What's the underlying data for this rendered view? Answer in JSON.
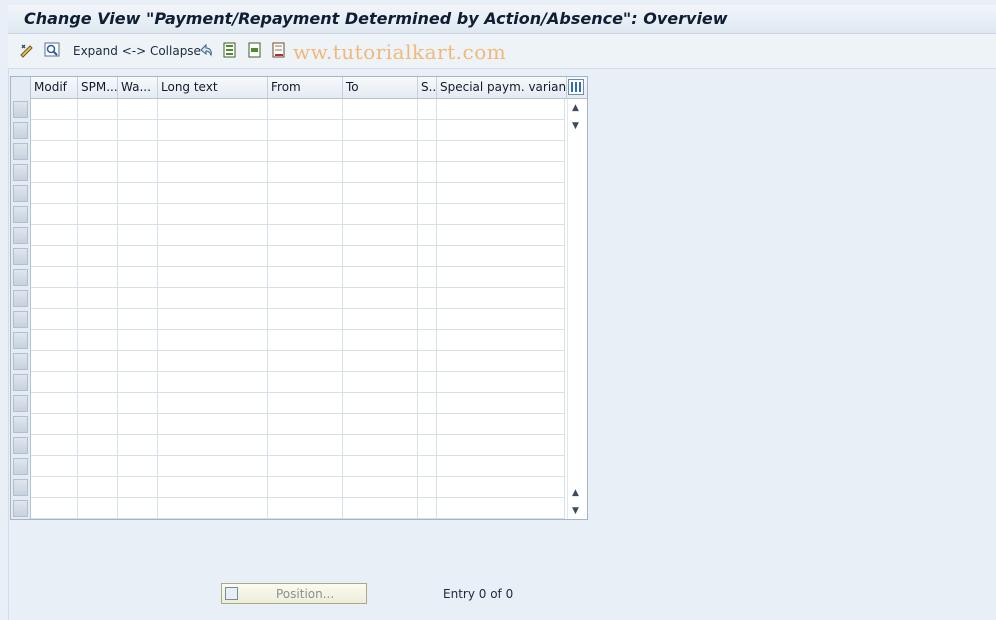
{
  "window": {
    "title": "Change View \"Payment/Repayment Determined by Action/Absence\": Overview"
  },
  "toolbar": {
    "expand_collapse_label": "Expand <-> Collapse",
    "icons": [
      "edit-glasses-icon",
      "find-icon",
      "undo-icon",
      "select-all-icon",
      "select-block-icon",
      "deselect-all-icon"
    ]
  },
  "watermark": "ww.tutorialkart.com",
  "table": {
    "columns": [
      "Modif",
      "SPM...",
      "Wa...",
      "Long text",
      "From",
      "To",
      "S..",
      "Special paym. variant"
    ],
    "row_count": 20,
    "rows": []
  },
  "footer": {
    "position_button_label": "Position...",
    "entry_text": "Entry 0 of 0"
  }
}
